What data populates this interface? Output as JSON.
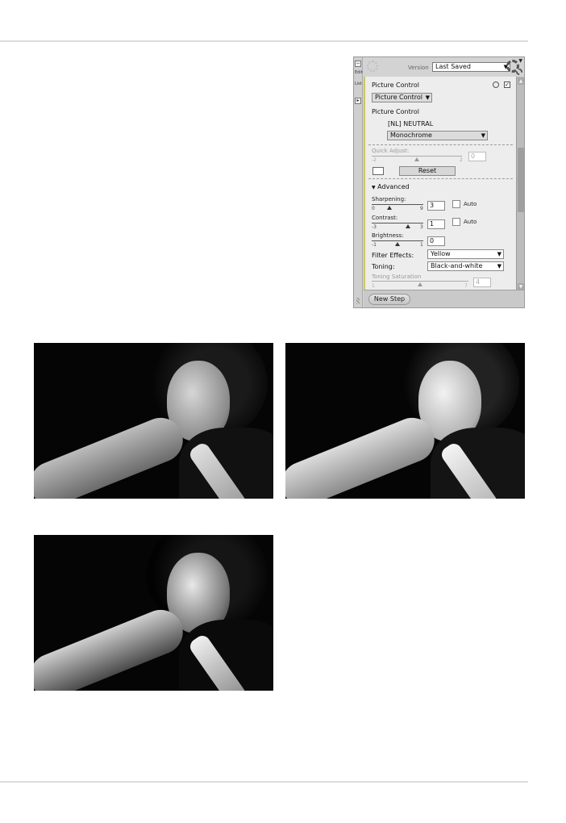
{
  "panel": {
    "sidebar": {
      "tab1": "Edit",
      "tab2": "List"
    },
    "version_label": "Version",
    "version_value": "Last Saved",
    "section_title": "Picture Control",
    "picture_control_dropdown": "Picture Control",
    "picture_control_label": "Picture Control",
    "current_setting": "[NL] NEUTRAL",
    "mode_dropdown": "Monochrome",
    "quick_adjust": {
      "label": "Quick Adjust:",
      "min": "-2",
      "max": "2",
      "value": "0"
    },
    "reset_label": "Reset",
    "advanced_label": "Advanced",
    "sharpening": {
      "label": "Sharpening:",
      "min": "0",
      "max": "9",
      "value": "3",
      "auto_label": "Auto"
    },
    "contrast": {
      "label": "Contrast:",
      "min": "-3",
      "max": "3",
      "value": "1",
      "auto_label": "Auto"
    },
    "brightness": {
      "label": "Brightness:",
      "min": "-1",
      "max": "1",
      "value": "0"
    },
    "filter_effects": {
      "label": "Filter Effects:",
      "value": "Yellow"
    },
    "toning": {
      "label": "Toning:",
      "value": "Black-and-white"
    },
    "toning_saturation": {
      "label": "Toning Saturation",
      "min": "1",
      "max": "7",
      "value": "4"
    },
    "new_step_label": "New Step"
  },
  "photos": [
    {
      "name": "photo-1",
      "tone": "neutral"
    },
    {
      "name": "photo-2",
      "tone": "bright"
    },
    {
      "name": "photo-3",
      "tone": "high-contrast"
    }
  ]
}
